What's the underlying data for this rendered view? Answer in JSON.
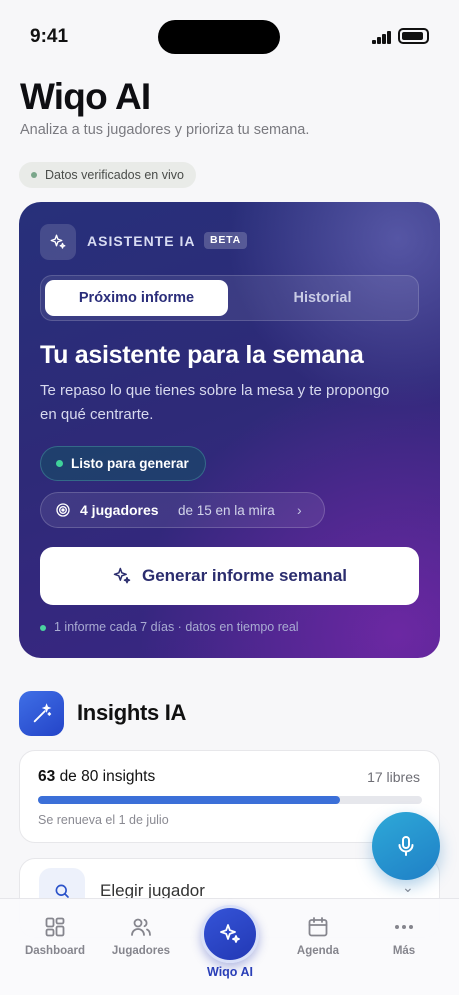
{
  "status_bar": {
    "time": "9:41"
  },
  "header": {
    "title": "Wiqo AI",
    "subtitle": "Analiza a tus jugadores y prioriza tu semana.",
    "verified": "Datos verificados en vivo"
  },
  "assistant": {
    "label": "ASISTENTE IA",
    "badge": "BETA",
    "tabs": [
      "Próximo informe",
      "Historial"
    ],
    "heading": "Tu asistente para la semana",
    "description": "Te repaso lo que tienes sobre la mesa y te propongo en qué centrarte.",
    "status": "Listo para generar",
    "players_count": "4 jugadores",
    "players_context": "de 15 en la mira",
    "button": "Generar informe semanal",
    "footer": "1 informe cada 7 días · datos en tiempo real"
  },
  "insights": {
    "title": "Insights IA",
    "used": "63",
    "of_text": "de 80 insights",
    "free": "17 libres",
    "progress_fraction": 0.7875,
    "renew": "Se renueva el 1 de julio",
    "choose_player": "Elegir jugador"
  },
  "tabbar": {
    "items": [
      "Dashboard",
      "Jugadores",
      "Wiqo AI",
      "Agenda",
      "Más"
    ]
  },
  "colors": {
    "primary": "#2a3fb8",
    "accent_green": "#3fd39a",
    "progress": "#3b6fd8"
  }
}
